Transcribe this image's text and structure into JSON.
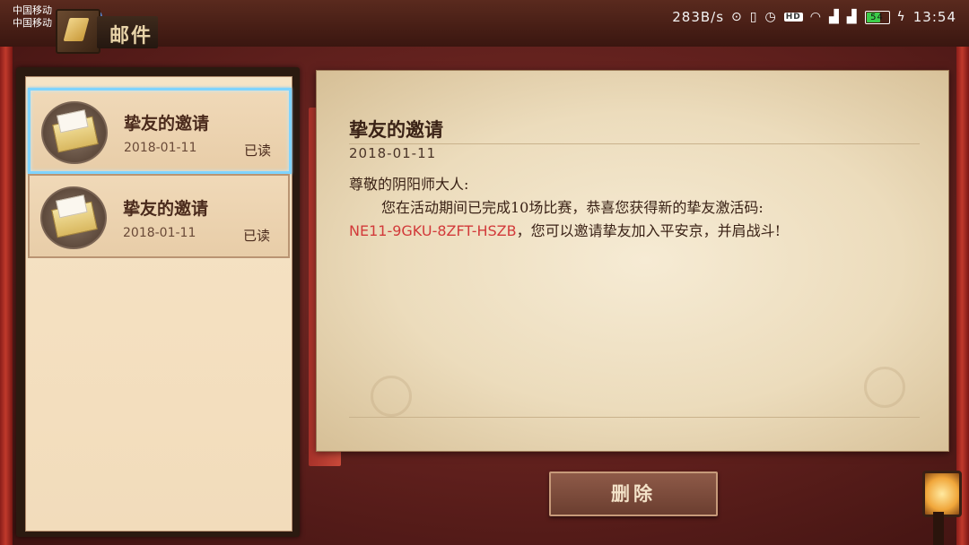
{
  "status_bar": {
    "carrier_1": "中国移动",
    "carrier_2": "中国移动",
    "speed": "283B/s",
    "battery": "54",
    "time": "13:54",
    "icons": [
      "location-icon",
      "vibrate-icon",
      "alarm-icon",
      "hd-icon",
      "wifi-icon",
      "signal-2g-icon",
      "signal-4g-icon",
      "battery-icon",
      "charging-icon"
    ]
  },
  "header": {
    "title": "邮件",
    "icon": "mail-quill-icon"
  },
  "mail_list": [
    {
      "title": "挚友的邀请",
      "date": "2018-01-11",
      "status": "已读",
      "selected": true
    },
    {
      "title": "挚友的邀请",
      "date": "2018-01-11",
      "status": "已读",
      "selected": false
    }
  ],
  "letter": {
    "title": "挚友的邀请",
    "date": "2018-01-11",
    "greeting": "尊敬的阴阳师大人:",
    "body_1": "您在活动期间已完成10场比赛，恭喜您获得新的挚友激活码:",
    "code": "NE11-9GKU-8ZFT-HSZB",
    "body_2": "，您可以邀请挚友加入平安京，并肩战斗!"
  },
  "actions": {
    "delete_label": "删除"
  },
  "colors": {
    "accent_code": "#d23a3a",
    "selection_border": "#7fd4ff",
    "background": "#5e1f1c"
  }
}
